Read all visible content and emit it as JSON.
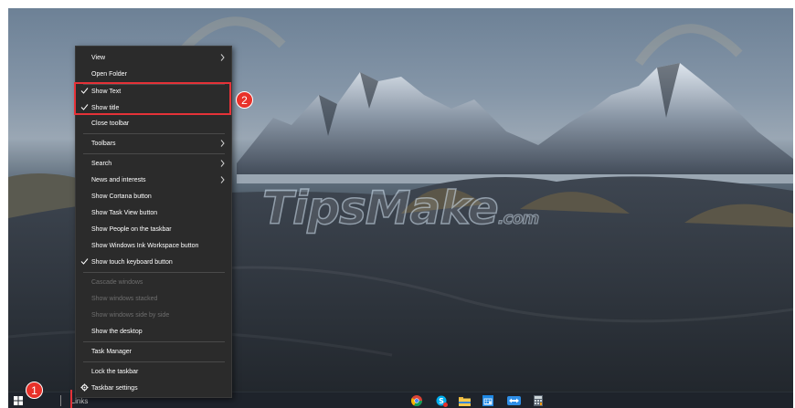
{
  "context_menu": {
    "items": [
      {
        "label": "View",
        "submenu": true,
        "checked": false,
        "disabled": false
      },
      {
        "label": "Open Folder",
        "submenu": false,
        "checked": false,
        "disabled": false
      },
      {
        "label": "Show Text",
        "submenu": false,
        "checked": true,
        "disabled": false
      },
      {
        "label": "Show title",
        "submenu": false,
        "checked": true,
        "disabled": false
      },
      {
        "label": "Close toolbar",
        "submenu": false,
        "checked": false,
        "disabled": false
      },
      {
        "label": "Toolbars",
        "submenu": true,
        "checked": false,
        "disabled": false
      },
      {
        "label": "Search",
        "submenu": true,
        "checked": false,
        "disabled": false
      },
      {
        "label": "News and interests",
        "submenu": true,
        "checked": false,
        "disabled": false
      },
      {
        "label": "Show Cortana button",
        "submenu": false,
        "checked": false,
        "disabled": false
      },
      {
        "label": "Show Task View button",
        "submenu": false,
        "checked": false,
        "disabled": false
      },
      {
        "label": "Show People on the taskbar",
        "submenu": false,
        "checked": false,
        "disabled": false
      },
      {
        "label": "Show Windows Ink Workspace button",
        "submenu": false,
        "checked": false,
        "disabled": false
      },
      {
        "label": "Show touch keyboard button",
        "submenu": false,
        "checked": true,
        "disabled": false
      },
      {
        "label": "Cascade windows",
        "submenu": false,
        "checked": false,
        "disabled": true
      },
      {
        "label": "Show windows stacked",
        "submenu": false,
        "checked": false,
        "disabled": true
      },
      {
        "label": "Show windows side by side",
        "submenu": false,
        "checked": false,
        "disabled": true
      },
      {
        "label": "Show the desktop",
        "submenu": false,
        "checked": false,
        "disabled": false
      },
      {
        "label": "Task Manager",
        "submenu": false,
        "checked": false,
        "disabled": false
      },
      {
        "label": "Lock the taskbar",
        "submenu": false,
        "checked": false,
        "disabled": false
      },
      {
        "label": "Taskbar settings",
        "submenu": false,
        "checked": false,
        "disabled": false,
        "icon": "gear-icon"
      }
    ]
  },
  "taskbar": {
    "start_icon": "windows-logo-icon",
    "links_label": "Links",
    "apps": [
      {
        "name": "chrome-icon"
      },
      {
        "name": "skype-icon"
      },
      {
        "name": "file-explorer-icon"
      },
      {
        "name": "calendar-icon"
      },
      {
        "name": "teamviewer-icon"
      },
      {
        "name": "calculator-icon"
      }
    ]
  },
  "annotations": {
    "badge_1": "1",
    "badge_2": "2",
    "highlight_color": "#e53238"
  },
  "watermark": {
    "text": "TipsMake",
    "suffix": ".com"
  }
}
